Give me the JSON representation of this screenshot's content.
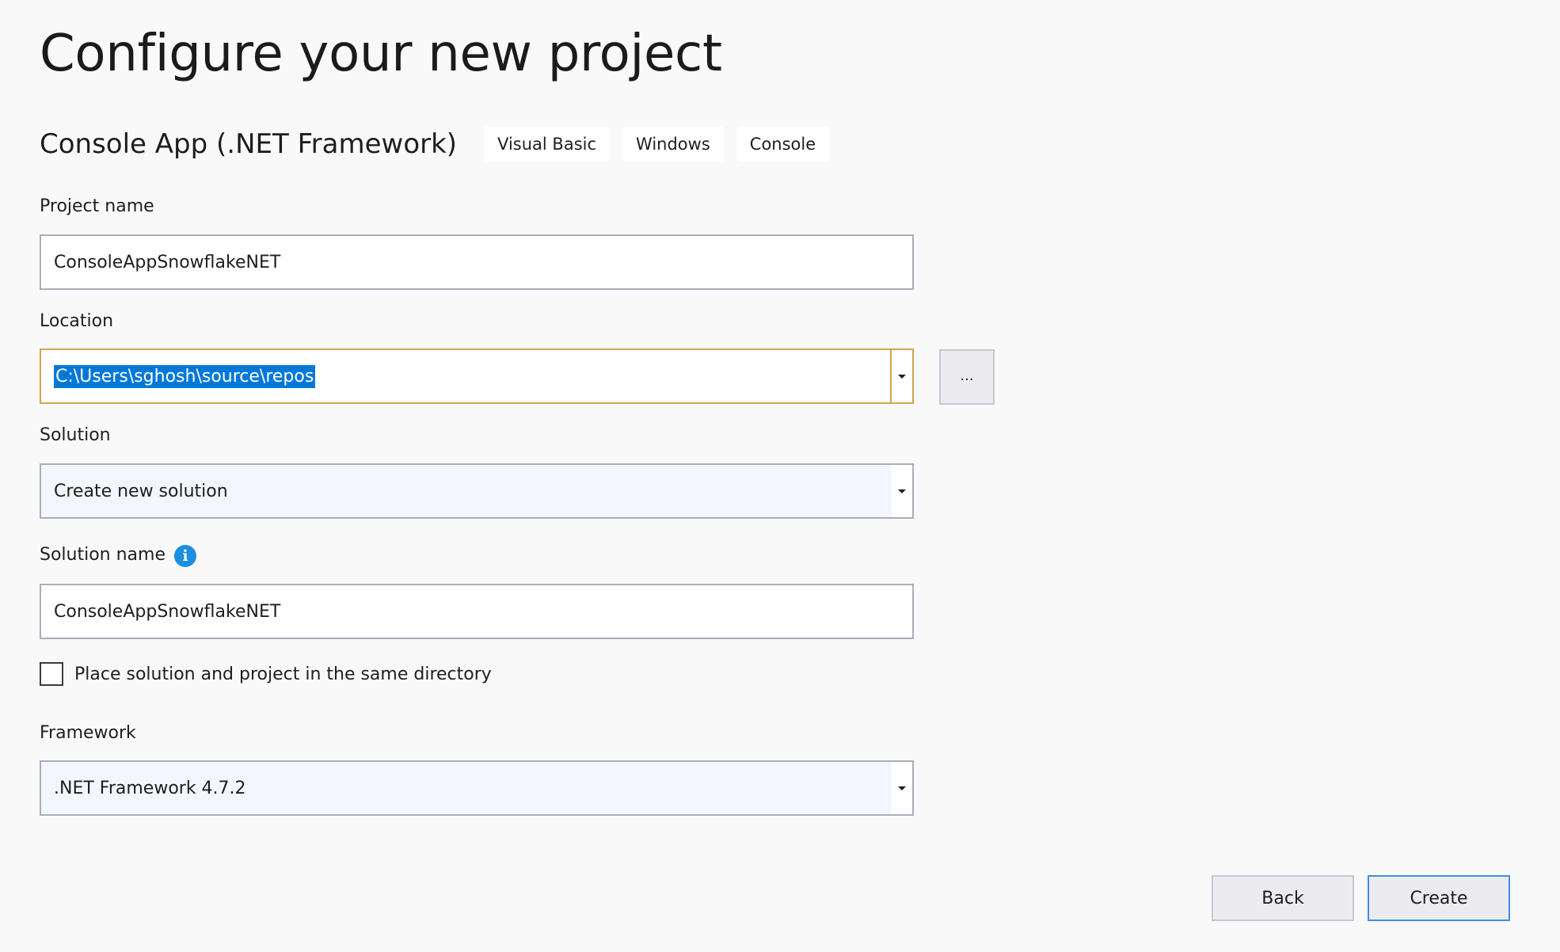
{
  "page": {
    "title": "Configure your new project"
  },
  "template": {
    "name": "Console App (.NET Framework)",
    "tags": [
      "Visual Basic",
      "Windows",
      "Console"
    ]
  },
  "form": {
    "project_name": {
      "label": "Project name",
      "value": "ConsoleAppSnowflakeNET"
    },
    "location": {
      "label": "Location",
      "value": "C:\\Users\\sghosh\\source\\repos",
      "browse_label": "..."
    },
    "solution": {
      "label": "Solution",
      "selected": "Create new solution"
    },
    "solution_name": {
      "label": "Solution name",
      "value": "ConsoleAppSnowflakeNET",
      "info_glyph": "i"
    },
    "same_directory": {
      "label": "Place solution and project in the same directory",
      "checked": false
    },
    "framework": {
      "label": "Framework",
      "selected": ".NET Framework 4.7.2"
    }
  },
  "actions": {
    "back_label": "Back",
    "create_label": "Create"
  },
  "colors": {
    "background": "#f9f9f9",
    "selection": "#0078d7",
    "focus_border": "#d7a54a",
    "info_icon": "#1a8ee1",
    "default_button_border": "#3b8ee5"
  }
}
